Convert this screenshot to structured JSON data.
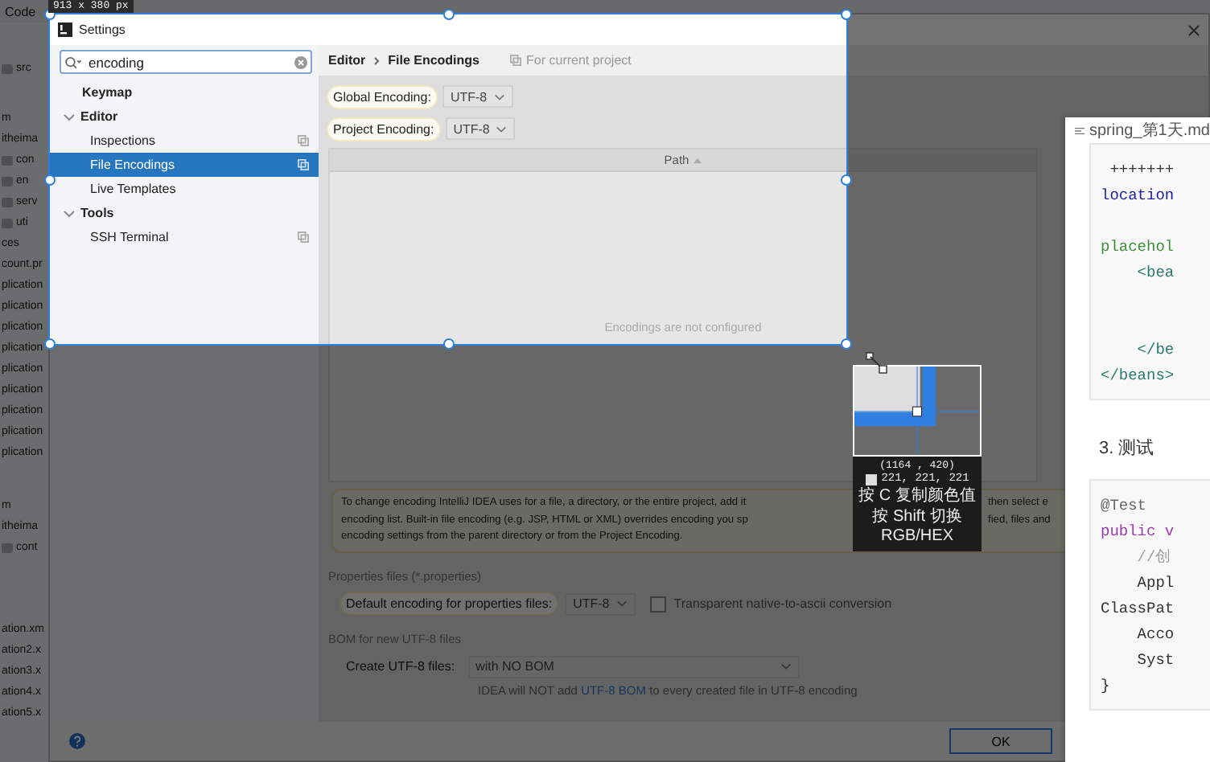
{
  "ide": {
    "menu": [
      "Code"
    ],
    "tree_groups": [
      [
        {
          "text": "src",
          "kind": "folder"
        }
      ],
      [
        {
          "text": "m",
          "kind": "plain"
        },
        {
          "text": "itheima",
          "kind": "plain"
        },
        {
          "text": "con",
          "kind": "folder"
        },
        {
          "text": "en",
          "kind": "folder"
        },
        {
          "text": "serv",
          "kind": "folder"
        },
        {
          "text": "uti",
          "kind": "folder"
        },
        {
          "text": "ces",
          "kind": "plain"
        },
        {
          "text": "count.pr",
          "kind": "plain"
        },
        {
          "text": "plication",
          "kind": "plain"
        },
        {
          "text": "plication",
          "kind": "plain"
        },
        {
          "text": "plication",
          "kind": "plain"
        },
        {
          "text": "plication",
          "kind": "plain"
        },
        {
          "text": "plication",
          "kind": "plain"
        },
        {
          "text": "plication",
          "kind": "plain"
        },
        {
          "text": "plication",
          "kind": "plain"
        },
        {
          "text": "plication",
          "kind": "plain"
        },
        {
          "text": "plication",
          "kind": "plain"
        }
      ],
      [
        {
          "text": "m",
          "kind": "plain"
        },
        {
          "text": "itheima",
          "kind": "plain"
        },
        {
          "text": "cont",
          "kind": "folder"
        }
      ],
      [
        {
          "text": "ation.xm",
          "kind": "plain"
        },
        {
          "text": "ation2.x",
          "kind": "plain"
        },
        {
          "text": "ation3.x",
          "kind": "plain"
        },
        {
          "text": "ation4.x",
          "kind": "plain"
        },
        {
          "text": "ation5.x",
          "kind": "plain"
        }
      ]
    ]
  },
  "settings": {
    "title": "Settings",
    "search": {
      "value": "encoding"
    },
    "tree": [
      {
        "label": "Keymap",
        "selected": false
      },
      {
        "label": "Editor",
        "expanded": true,
        "selected": false,
        "children": [
          {
            "label": "Inspections",
            "selected": false,
            "project_scope": true
          },
          {
            "label": "File Encodings",
            "selected": true,
            "project_scope": true
          },
          {
            "label": "Live Templates",
            "selected": false,
            "project_scope": false
          }
        ]
      },
      {
        "label": "Tools",
        "expanded": true,
        "selected": false,
        "children": [
          {
            "label": "SSH Terminal",
            "selected": false,
            "project_scope": true
          }
        ]
      }
    ],
    "breadcrumb": [
      "Editor",
      "File Encodings"
    ],
    "scope_note": "For current project",
    "encodings": [
      {
        "label": "Global Encoding:",
        "value": "UTF-8",
        "highlighted": true
      },
      {
        "label": "Project Encoding:",
        "value": "UTF-8",
        "highlighted": true
      }
    ],
    "table": {
      "columns": [
        {
          "label": "Path",
          "sort_ascending": true
        }
      ],
      "empty_text": "Encodings are not configured"
    },
    "info_lines": [
      {
        "left": "To change encoding IntelliJ IDEA uses for a file, a directory, or the entire project, add it",
        "right": "then select e"
      },
      {
        "left": "encoding list. Built-in file encoding (e.g. JSP, HTML or XML) overrides encoding you sp",
        "right": "fied, files and"
      },
      {
        "left": "encoding settings from the parent directory or from the Project Encoding."
      }
    ],
    "properties": {
      "heading": "Properties files (*.properties)",
      "label": "Default encoding for properties files:",
      "highlighted": true,
      "value": "UTF-8",
      "native_to_ascii": {
        "label": "Transparent native-to-ascii conversion",
        "checked": false
      }
    },
    "bom": {
      "heading": "BOM for new UTF-8 files",
      "label": "Create UTF-8 files:",
      "highlighted": false,
      "value": "with NO BOM",
      "note_before": "IDEA will NOT add",
      "note_link": "UTF-8 BOM",
      "note_after": "to every created file in UTF-8 encoding"
    },
    "buttons": [
      {
        "label": "OK",
        "default": true
      }
    ]
  },
  "capture": {
    "size_label": "913 x 380 px",
    "magnifier": {
      "coordinates": "(1164 , 420)",
      "color_value": "221, 221, 221",
      "hints": [
        "按 C 复制颜色值",
        "按 Shift 切换 RGB/HEX"
      ]
    }
  },
  "markdown": {
    "file_name": "spring_第1天.md",
    "blocks": [
      {
        "kind": "code",
        "lines": [
          {
            "kind": "plain",
            "text": " +++++++"
          },
          {
            "kind": "attr",
            "text": "location"
          },
          {
            "kind": "blank"
          },
          {
            "kind": "string",
            "text": "placehol"
          },
          {
            "kind": "tag",
            "text": "    <bea"
          },
          {
            "kind": "blank"
          },
          {
            "kind": "blank"
          },
          {
            "kind": "tag",
            "text": "    </be"
          },
          {
            "kind": "tag",
            "text": "</beans>"
          }
        ]
      },
      {
        "kind": "heading",
        "text": "3. 测试"
      },
      {
        "kind": "code",
        "lines": [
          {
            "kind": "annotation",
            "text": "@Test"
          },
          {
            "kind": "keyword",
            "text": "public v"
          },
          {
            "kind": "comment",
            "text": "    //创"
          },
          {
            "kind": "plain",
            "text": "    Appl"
          },
          {
            "kind": "plain",
            "text": "ClassPat"
          },
          {
            "kind": "plain",
            "text": "    Acco"
          },
          {
            "kind": "plain",
            "text": "    Syst"
          },
          {
            "kind": "plain",
            "text": "}"
          }
        ]
      }
    ]
  }
}
